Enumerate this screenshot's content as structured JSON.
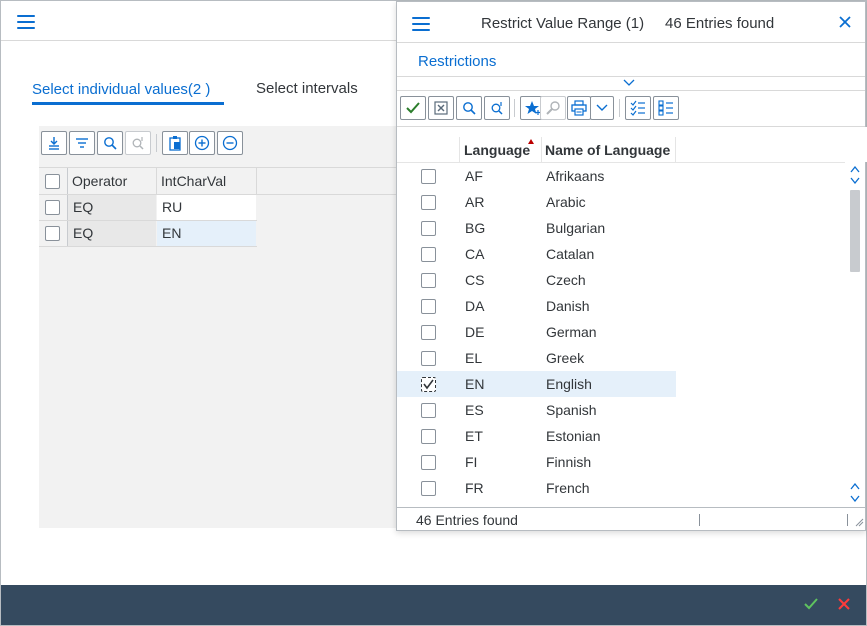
{
  "main": {
    "tabs": [
      {
        "label": "Select individual values(2 )"
      },
      {
        "label": "Select intervals"
      }
    ],
    "table": {
      "headers": [
        "Operator",
        "IntCharVal"
      ],
      "rows": [
        {
          "operator": "EQ",
          "value": "RU"
        },
        {
          "operator": "EQ",
          "value": "EN"
        }
      ]
    }
  },
  "popup": {
    "title": "Restrict Value Range (1)",
    "entries_found": "46 Entries found",
    "restrictions_label": "Restrictions",
    "columns": [
      "Language",
      "Name of Language"
    ],
    "rows": [
      {
        "code": "AF",
        "name": "Afrikaans",
        "checked": false
      },
      {
        "code": "AR",
        "name": "Arabic",
        "checked": false
      },
      {
        "code": "BG",
        "name": "Bulgarian",
        "checked": false
      },
      {
        "code": "CA",
        "name": "Catalan",
        "checked": false
      },
      {
        "code": "CS",
        "name": "Czech",
        "checked": false
      },
      {
        "code": "DA",
        "name": "Danish",
        "checked": false
      },
      {
        "code": "DE",
        "name": "German",
        "checked": false
      },
      {
        "code": "EL",
        "name": "Greek",
        "checked": false
      },
      {
        "code": "EN",
        "name": "English",
        "checked": true
      },
      {
        "code": "ES",
        "name": "Spanish",
        "checked": false
      },
      {
        "code": "ET",
        "name": "Estonian",
        "checked": false
      },
      {
        "code": "FI",
        "name": "Finnish",
        "checked": false
      },
      {
        "code": "FR",
        "name": "French",
        "checked": false
      }
    ],
    "status_text": "46 Entries found"
  },
  "colors": {
    "accent": "#0a6ed1",
    "confirm": "#2b7d2b",
    "cancel": "#bb0000",
    "footer": "#354a5f"
  }
}
